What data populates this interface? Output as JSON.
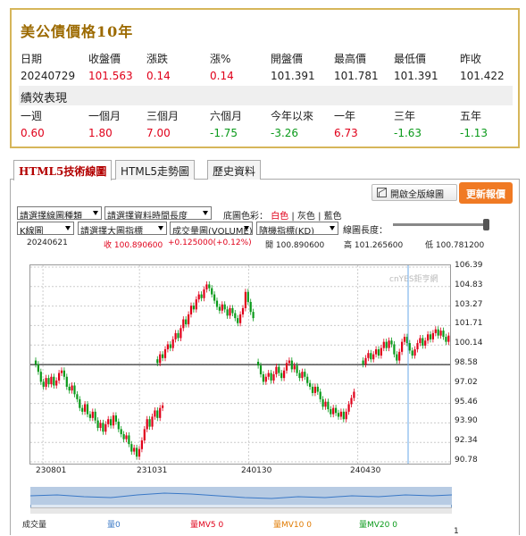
{
  "quote": {
    "title": "美公債價格10年",
    "headers": [
      "日期",
      "收盤價",
      "漲跌",
      "漲%",
      "開盤價",
      "最高價",
      "最低價",
      "昨收"
    ],
    "values": [
      "20240729",
      "101.563",
      "0.14",
      "0.14",
      "101.391",
      "101.781",
      "101.391",
      "101.422"
    ],
    "perf_title": "績效表現",
    "perf_headers": [
      "一週",
      "一個月",
      "三個月",
      "六個月",
      "今年以來",
      "一年",
      "三年",
      "五年"
    ],
    "perf_values": [
      "0.60",
      "1.80",
      "7.00",
      "-1.75",
      "-3.26",
      "6.73",
      "-1.63",
      "-1.13"
    ]
  },
  "tabs": [
    "HTML5技術線圖",
    "HTML5走勢圖",
    "歷史資料"
  ],
  "toolbar": {
    "open_full": "開啟全版線圖",
    "update": "更新報價",
    "select_chart_type": "請選擇線圖種類",
    "select_period": "請選擇資料時間長度",
    "bg_color_label": "底圖色彩：",
    "bg_white": "白色",
    "bg_gray": "灰色",
    "bg_blue": "藍色",
    "sep": "|",
    "chart_kind": "K線圖",
    "select_main_indicator": "請選擇大圖指標",
    "volume_indicator": "成交量圖(VOLUME)",
    "stoch_indicator": "隨機指標(KD)",
    "length_label": "線圖長度："
  },
  "info": {
    "date": "20240621",
    "close": "收 100.890600",
    "change": "+0.125000(+0.12%)",
    "open": "開 100.890600",
    "high": "高 101.265600",
    "low": "低 100.781200"
  },
  "watermark": "cnYES鉅亨網",
  "chart_data": {
    "type": "candlestick",
    "y_ticks": [
      "106.39",
      "104.83",
      "103.27",
      "101.71",
      "100.14",
      "98.58",
      "97.02",
      "95.46",
      "93.90",
      "92.34",
      "90.78"
    ],
    "ylim": [
      90.78,
      106.39
    ],
    "x_ticks": [
      "230801",
      "231031",
      "240130",
      "240430"
    ],
    "segments": [
      {
        "start_x": 0.0,
        "closes": [
          98.6,
          98.0,
          97.2,
          96.8,
          97.5,
          97.0,
          97.6,
          96.9,
          97.3,
          97.9,
          98.1,
          97.6,
          96.8,
          96.5,
          96.9,
          96.2,
          95.8,
          95.1,
          94.8,
          95.4,
          94.6,
          94.3,
          94.8,
          94.1,
          93.5,
          93.9,
          93.2,
          93.8,
          94.2,
          93.7,
          94.5,
          94.0,
          93.4,
          93.0,
          92.6,
          92.9,
          92.2,
          91.6,
          91.9,
          91.2,
          91.8,
          92.5,
          93.4,
          94.2,
          93.6,
          94.4,
          94.9,
          94.3,
          95.1,
          95.3
        ]
      },
      {
        "start_x": 0.29,
        "closes": [
          98.7,
          99.4,
          99.1,
          99.8,
          100.2,
          99.9,
          100.6,
          101.1,
          100.7,
          101.5,
          102.2,
          101.8,
          102.6,
          103.3,
          103.0,
          103.8,
          104.2,
          103.9,
          104.6,
          105.0,
          104.7,
          104.2,
          103.7,
          103.2,
          102.9,
          103.4,
          103.0,
          102.5,
          103.1,
          102.7,
          102.3,
          101.9,
          102.6,
          103.1,
          104.4,
          103.6,
          102.8,
          102.3
        ]
      },
      {
        "start_x": 0.53,
        "closes": [
          98.5,
          97.8,
          97.2,
          97.6,
          97.9,
          97.3,
          97.8,
          98.4,
          97.9,
          97.5,
          98.1,
          98.7,
          98.9,
          98.2,
          98.5,
          97.9,
          97.5,
          98.0,
          97.6,
          97.1,
          96.8,
          96.3,
          96.8,
          96.4,
          95.8,
          95.2,
          95.6,
          95.0,
          94.6,
          95.1,
          94.7,
          94.4,
          94.8,
          94.2,
          94.8,
          95.4,
          95.9,
          96.4
        ]
      },
      {
        "start_x": 0.78,
        "closes": [
          98.6,
          99.1,
          99.5,
          99.0,
          99.4,
          99.8,
          99.3,
          99.9,
          100.4,
          99.9,
          100.5,
          100.2,
          99.4,
          98.9,
          99.6,
          100.4,
          100.8,
          100.3,
          99.7,
          99.3,
          99.8,
          100.3,
          100.7,
          100.1,
          100.5,
          101.0,
          100.6,
          101.1,
          101.4,
          100.9,
          101.3,
          100.8,
          100.4,
          100.9,
          101.2
        ]
      }
    ],
    "reference_line": 98.58,
    "cursor_x": 0.9
  },
  "volume": {
    "label": "成交量",
    "v": "量0",
    "mv5": "量MV5 0",
    "mv10": "量MV10 0",
    "mv20": "量MV20 0",
    "page": "1"
  }
}
